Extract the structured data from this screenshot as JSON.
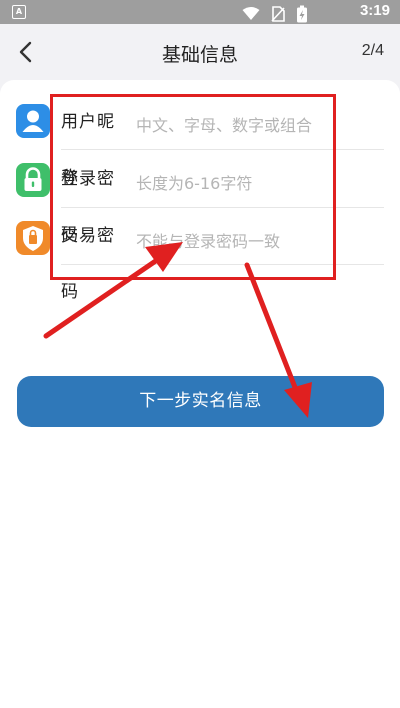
{
  "status_bar": {
    "badge": "A",
    "time": "3:19",
    "icons": [
      "wifi-icon",
      "no-sim-icon",
      "battery-charging-icon"
    ]
  },
  "header": {
    "back_icon": "chevron-left-icon",
    "title": "基础信息",
    "step": "2/4"
  },
  "form": {
    "rows": [
      {
        "icon": "user-icon",
        "icon_color": "#2d8ee6",
        "label": "用户昵称",
        "placeholder": "中文、字母、数字或组合"
      },
      {
        "icon": "lock-icon",
        "icon_color": "#3fbf6a",
        "label": "登录密码",
        "placeholder": "长度为6-16字符"
      },
      {
        "icon": "shield-icon",
        "icon_color": "#f08a2a",
        "label": "交易密码",
        "placeholder": "不能与登录密码一致"
      }
    ]
  },
  "next_button": {
    "label": "下一步实名信息",
    "color": "#2f78b9"
  },
  "annotation": {
    "color": "#e02020"
  }
}
